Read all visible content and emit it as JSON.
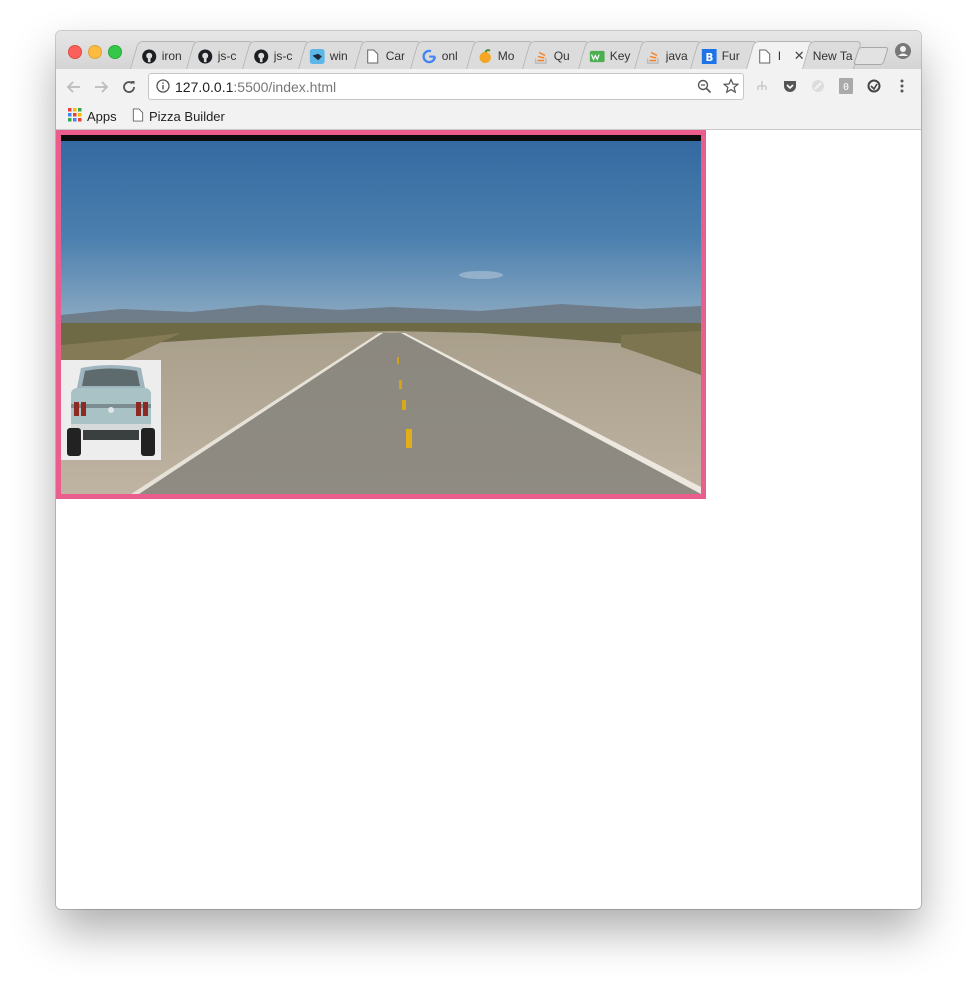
{
  "browser": {
    "tabs": [
      {
        "title": "iron",
        "favicon": "github-icon"
      },
      {
        "title": "js-c",
        "favicon": "github-icon"
      },
      {
        "title": "js-c",
        "favicon": "github-icon"
      },
      {
        "title": "win",
        "favicon": "bird-icon"
      },
      {
        "title": "Car",
        "favicon": "page-icon"
      },
      {
        "title": "onl",
        "favicon": "google-icon"
      },
      {
        "title": "Mo",
        "favicon": "fruit-icon"
      },
      {
        "title": "Qu",
        "favicon": "stackoverflow-icon"
      },
      {
        "title": "Key",
        "favicon": "w3-icon"
      },
      {
        "title": "java",
        "favicon": "stackoverflow-icon"
      },
      {
        "title": "Fur",
        "favicon": "b-icon"
      },
      {
        "title": "I",
        "favicon": "page-icon",
        "active": true
      },
      {
        "title": "New Ta",
        "favicon": ""
      }
    ],
    "address": {
      "host": "127.0.0.1",
      "path": ":5500/index.html"
    },
    "bookmarks": [
      {
        "label": "Apps",
        "icon": "apps-grid-icon"
      },
      {
        "label": "Pizza Builder",
        "icon": "page-icon"
      }
    ]
  },
  "page": {
    "scene": "road-background",
    "car": "car-rear-image",
    "colors": {
      "frame": "#ea5d8d",
      "sky": "#3f6fa4",
      "road": "#8c8880"
    }
  }
}
